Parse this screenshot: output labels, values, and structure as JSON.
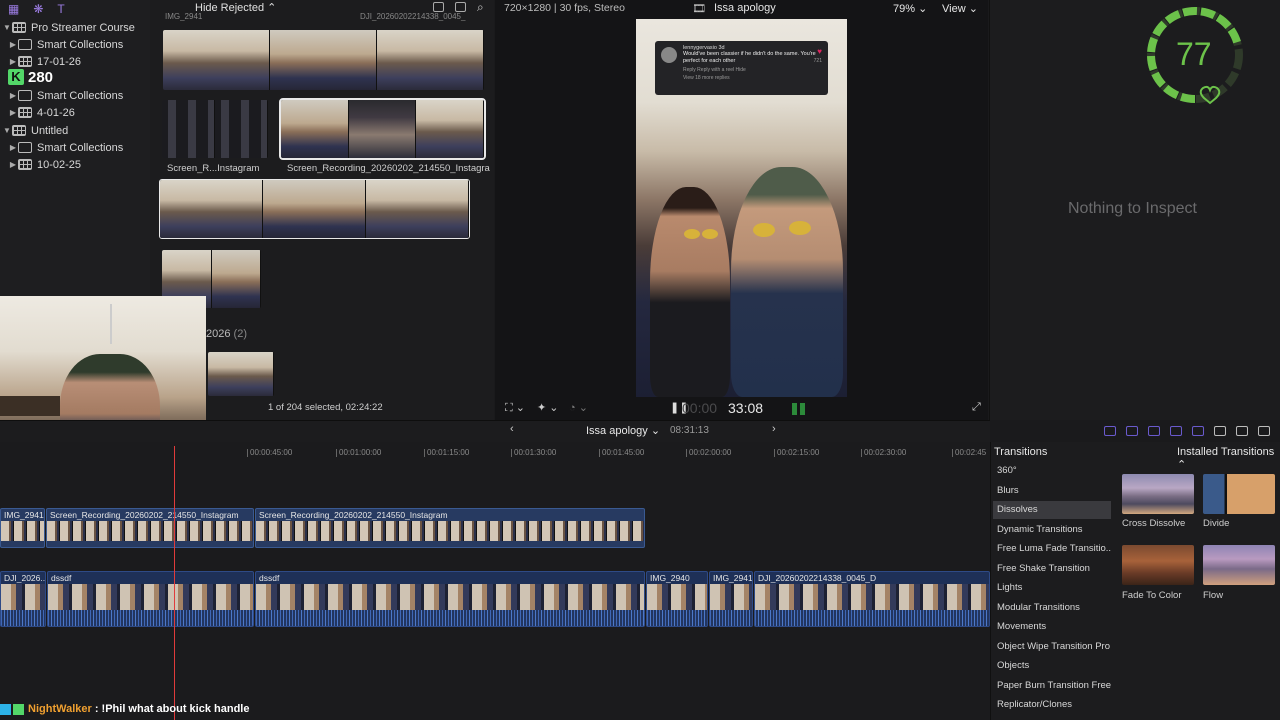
{
  "sidebar": {
    "items": [
      {
        "label": "Pro Streamer Course",
        "kind": "library"
      },
      {
        "label": "Smart Collections",
        "kind": "folder"
      },
      {
        "label": "17-01-26",
        "kind": "event"
      },
      {
        "label": "Smart Collections",
        "kind": "folder"
      },
      {
        "label": "4-01-26",
        "kind": "event"
      },
      {
        "label": "Untitled",
        "kind": "library"
      },
      {
        "label": "Smart Collections",
        "kind": "folder"
      },
      {
        "label": "10-02-25",
        "kind": "event"
      }
    ],
    "overlay_count": "280"
  },
  "browser": {
    "top_partial_labels": [
      "IMG_2941",
      "DJI_20260202214338_0045_"
    ],
    "hide_rejected": "Hide Rejected",
    "clips": [
      {
        "label": "Screen_R...Instagram"
      },
      {
        "label": "Screen_Recording_20260202_214550_Instagra"
      }
    ],
    "group_year": "2026",
    "group_count": "(2)",
    "selection_status": "1 of 204 selected, 02:24:22"
  },
  "viewer": {
    "format_info": "720×1280 | 30 fps, Stereo",
    "project_title": "Issa apology",
    "zoom": "79%",
    "view_menu": "View",
    "timecode_dim": "00:00",
    "timecode": "33:08",
    "comment": {
      "user": "lennygervasio 3d",
      "text": "Would've been classier if he didn't do the same. You're perfect for each other",
      "meta": "Reply   Reply with a reel   Hide",
      "more": "View 18 more replies",
      "likes": "721"
    }
  },
  "inspector": {
    "empty_text": "Nothing to Inspect"
  },
  "gauge": {
    "value": "77",
    "fraction": 0.77,
    "color": "#6cc24a"
  },
  "timeline": {
    "project": "Issa apology",
    "duration": "08:31:13",
    "ticks": [
      "00:00:45:00",
      "00:01:00:00",
      "00:01:15:00",
      "00:01:30:00",
      "00:01:45:00",
      "00:02:00:00",
      "00:02:15:00",
      "00:02:30:00",
      "00:02:45"
    ],
    "connected_clips": [
      {
        "label": "IMG_2941"
      },
      {
        "label": "Screen_Recording_20260202_214550_Instagram"
      },
      {
        "label": "Screen_Recording_20260202_214550_Instagram"
      }
    ],
    "primary_clips": [
      {
        "label": "DJI_2026..."
      },
      {
        "label": "dssdf"
      },
      {
        "label": "dssdf"
      },
      {
        "label": "IMG_2940"
      },
      {
        "label": "IMG_2941"
      },
      {
        "label": "DJI_20260202214338_0045_D"
      }
    ]
  },
  "transitions": {
    "title": "Transitions",
    "installed": "Installed Transitions",
    "categories": [
      "360°",
      "Blurs",
      "Dissolves",
      "Dynamic Transitions",
      "Free Luma Fade Transitio...",
      "Free Shake Transition",
      "Lights",
      "Modular Transitions",
      "Movements",
      "Object Wipe Transition Pro",
      "Objects",
      "Paper Burn Transition Free",
      "Replicator/Clones"
    ],
    "selected_category": "Dissolves",
    "thumbnails": [
      {
        "label": "Cross Dissolve"
      },
      {
        "label": "Divide"
      },
      {
        "label": "Fade To Color"
      },
      {
        "label": "Flow"
      }
    ]
  },
  "chat": {
    "user": "NightWalker",
    "separator": " : ",
    "message": "!Phil what about kick handle"
  },
  "colors": {
    "accent": "#7b68ee",
    "playhead": "#e03b3b",
    "gauge": "#6cc24a",
    "chat_user": "#f0a030"
  }
}
